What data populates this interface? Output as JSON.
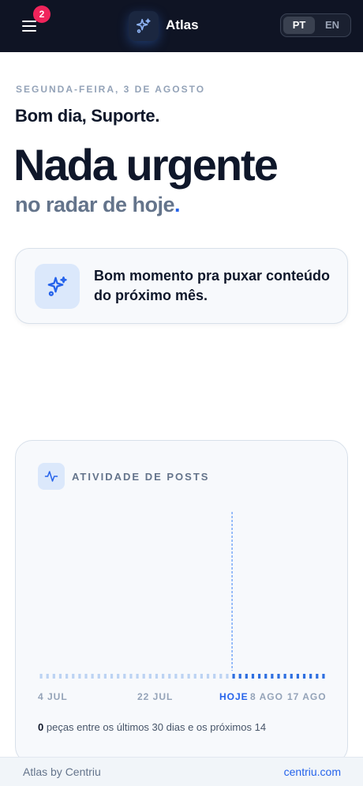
{
  "header": {
    "notification_count": "2",
    "brand": "Atlas",
    "languages": [
      "PT",
      "EN"
    ],
    "active_language": "PT",
    "icon": "sparkles-icon"
  },
  "greeting": {
    "date": "SEGUNDA-FEIRA, 3 DE AGOSTO",
    "hello": "Bom dia, Suporte.",
    "headline": "Nada urgente",
    "subline": "no radar de hoje",
    "subline_end": "."
  },
  "tip": {
    "text": "Bom momento pra puxar conteúdo do próximo mês.",
    "icon": "sparkles-icon"
  },
  "activity": {
    "title": "ATIVIDADE DE POSTS",
    "icon": "pulse-icon",
    "summary_count": "0",
    "summary_text": "peças entre os últimos 30 dias e os próximos 14"
  },
  "chart_data": {
    "type": "bar",
    "title": "ATIVIDADE DE POSTS",
    "x_ticks": [
      "4 JUL",
      "22 JUL",
      "HOJE",
      "8 AGO",
      "17 AGO"
    ],
    "today_marker": "HOJE",
    "past_days": 30,
    "future_days": 14,
    "values": [
      0,
      0,
      0,
      0,
      0,
      0,
      0,
      0,
      0,
      0,
      0,
      0,
      0,
      0,
      0,
      0,
      0,
      0,
      0,
      0,
      0,
      0,
      0,
      0,
      0,
      0,
      0,
      0,
      0,
      0,
      0,
      0,
      0,
      0,
      0,
      0,
      0,
      0,
      0,
      0,
      0,
      0,
      0,
      0,
      0
    ],
    "colors": {
      "past": "#bcd3f3",
      "future": "#2f6fe0",
      "today_line": "#3b82f6"
    }
  },
  "footer": {
    "left": "Atlas by Centriu",
    "right": "centriu.com"
  }
}
